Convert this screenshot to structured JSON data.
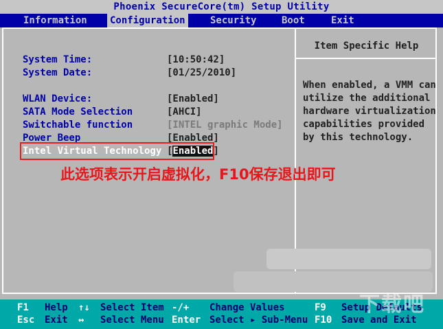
{
  "title": "Phoenix SecureCore(tm) Setup Utility",
  "menu": [
    "Information",
    "Configuration",
    "Security",
    "Boot",
    "Exit"
  ],
  "active_menu": "Configuration",
  "items": [
    {
      "label": "System Time:",
      "value": "[10:50:42]"
    },
    {
      "label": "System Date:",
      "value": "[01/25/2010]"
    },
    {
      "label": "WLAN Device:",
      "value": "[Enabled]"
    },
    {
      "label": "SATA Mode Selection",
      "value": "[AHCI]"
    },
    {
      "label": "Switchable function",
      "value": "[INTEL graphic Mode]"
    },
    {
      "label": "Power Beep",
      "value": "[Enabled]"
    },
    {
      "label": "Intel Virtual Technology",
      "value_open": "[",
      "value": "Enabled",
      "value_close": "]"
    }
  ],
  "help": {
    "title": "Item Specific Help",
    "lines": [
      "When enabled, a VMM can",
      "utilize the additional",
      "hardware virtualization",
      "capabilities provided",
      "by this technology."
    ]
  },
  "annotation": "此选项表示开启虚拟化，F10保存退出即可",
  "footer": {
    "row1": [
      {
        "key": "F1",
        "desc": "Help"
      },
      {
        "key": "↑↓",
        "desc": "Select Item"
      },
      {
        "key": "-/+",
        "desc": "Change Values"
      },
      {
        "key": "F9",
        "desc": "Setup Defaults"
      }
    ],
    "row2": [
      {
        "key": "Esc",
        "desc": "Exit"
      },
      {
        "key": "↔",
        "desc": "Select Menu"
      },
      {
        "key": "Enter",
        "desc": "Select ▸ Sub-Menu"
      },
      {
        "key": "F10",
        "desc": "Save and Exit"
      }
    ]
  },
  "watermark": "下载吧",
  "colors": {
    "background": "#b7b7b7",
    "menu_bar": "#0000a8",
    "label_blue": "#0000a8",
    "footer": "#00a8a8",
    "annotation_red": "#e8161b"
  }
}
